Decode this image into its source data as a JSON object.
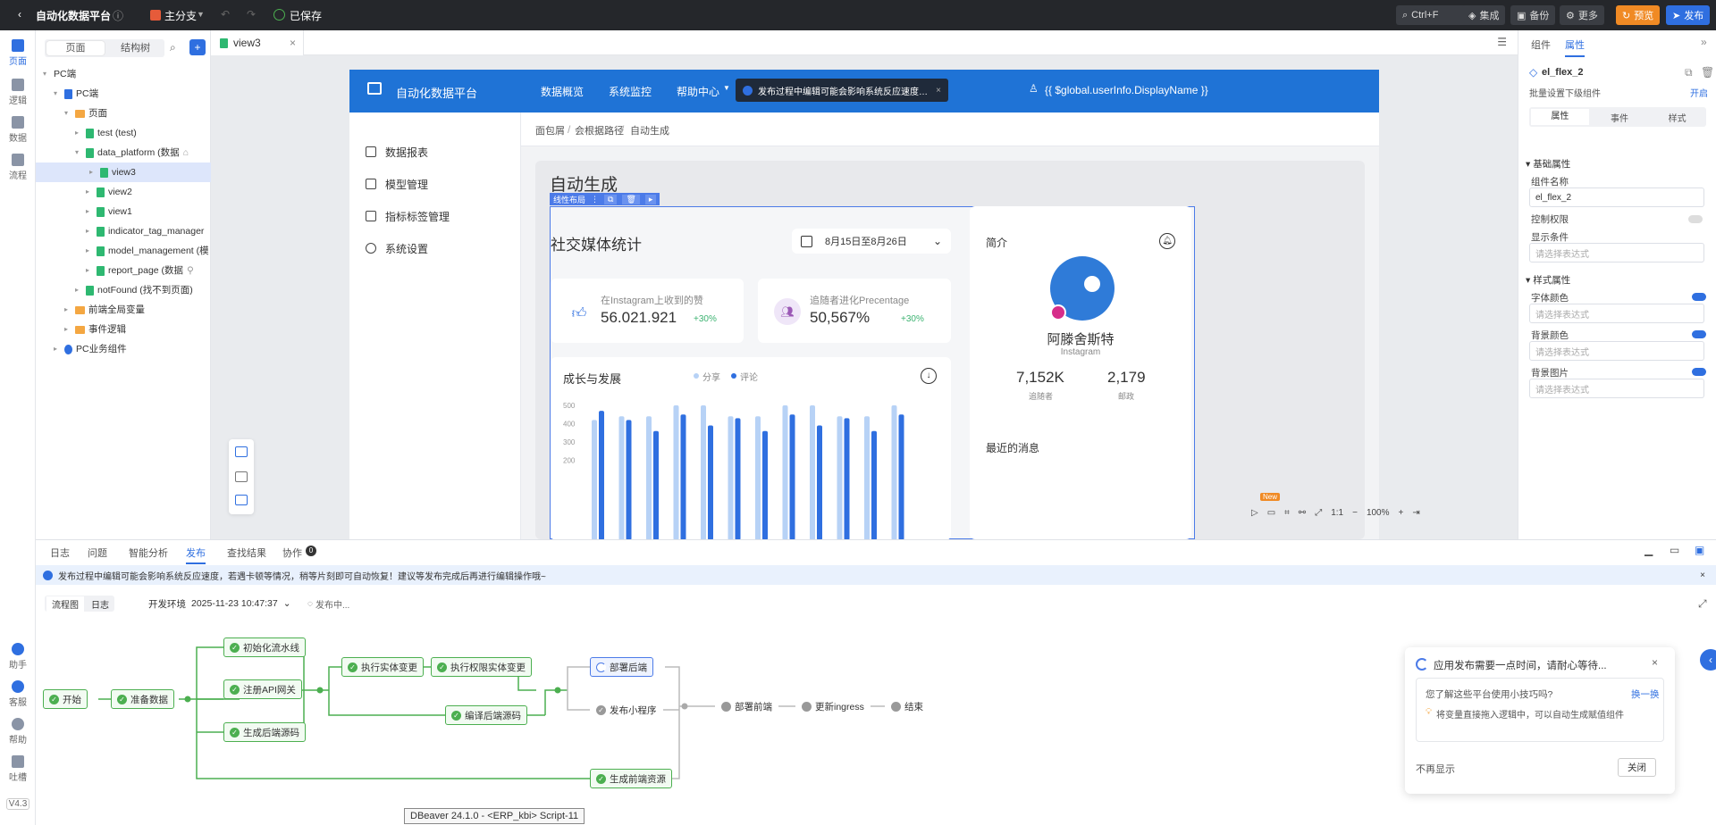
{
  "topbar": {
    "back_icon": "chevron-left-icon",
    "title": "自动化数据平台",
    "branch": "主分支",
    "saved": "已保存",
    "search_shortcut": "Ctrl+F",
    "integrate": "集成",
    "backup": "备份",
    "more": "更多",
    "preview": "预览",
    "publish": "发布"
  },
  "rail": {
    "items": [
      "页面",
      "逻辑",
      "数据",
      "流程"
    ],
    "bottom": [
      "助手",
      "客服",
      "帮助",
      "吐槽"
    ],
    "version": "V4.3"
  },
  "tree": {
    "tab_pages": "页面",
    "tab_structure": "结构树",
    "nodes": [
      {
        "label": "PC端"
      },
      {
        "label": "PC端"
      },
      {
        "label": "页面"
      },
      {
        "label": "test (test)"
      },
      {
        "label": "data_platform (数据"
      },
      {
        "label": "view3"
      },
      {
        "label": "view2"
      },
      {
        "label": "view1"
      },
      {
        "label": "indicator_tag_manager"
      },
      {
        "label": "model_management (模"
      },
      {
        "label": "report_page (数据"
      },
      {
        "label": "notFound (找不到页面)"
      },
      {
        "label": "前端全局变量"
      },
      {
        "label": "事件逻辑"
      },
      {
        "label": "PC业务组件"
      }
    ]
  },
  "editor_tab": {
    "label": "view3"
  },
  "app": {
    "title": "自动化数据平台",
    "nav": [
      "数据概览",
      "系统监控",
      "帮助中心"
    ],
    "toast": "发布过程中编辑可能会影响系统反应速度，请稍等片刻...",
    "user": "{{ $global.userInfo.DisplayName }}",
    "side": [
      "数据报表",
      "模型管理",
      "指标标签管理",
      "系统设置"
    ],
    "breadcrumb": [
      "面包屑",
      "会根据路径",
      "自动生成"
    ],
    "page_title": "自动生成",
    "selection_tag": "线性布局",
    "social_title": "社交媒体统计",
    "date_range": "8月15日至8月26日",
    "stat1_label": "在Instagram上收到的赞",
    "stat1_value": "56.021.921",
    "stat1_delta": "+30%",
    "stat2_label": "追随者进化Precentage",
    "stat2_value": "50,567%",
    "stat2_delta": "+30%",
    "growth_title": "成长与发展",
    "legend": [
      "分享",
      "评论"
    ],
    "intro_title": "简介",
    "profile_name": "阿滕舍斯特",
    "profile_sub": "Instagram",
    "followers": "7,152K",
    "followers_label": "追随者",
    "posts": "2,179",
    "posts_label": "邮政",
    "recent": "最近的消息",
    "new_badge": "New",
    "ratio": "1:1",
    "zoom": "100%"
  },
  "chart_data": {
    "type": "bar",
    "yticks": [
      500,
      400,
      300,
      200
    ],
    "series": [
      {
        "name": "分享",
        "values": [
          420,
          440,
          440,
          500,
          500,
          440,
          440,
          500,
          500,
          440,
          440,
          500
        ]
      },
      {
        "name": "评论",
        "values": [
          470,
          420,
          360,
          450,
          390,
          430,
          360,
          450,
          390,
          430,
          360,
          450
        ]
      }
    ],
    "colors": [
      "#b7d2f6",
      "#2f6fe0"
    ]
  },
  "right_panel": {
    "tab_components": "组件",
    "tab_props": "属性",
    "component_name": "el_flex_2",
    "batch_label": "批量设置下级组件",
    "batch_toggle": "开启",
    "sub_tabs": [
      "属性",
      "事件",
      "样式"
    ],
    "sec_basic": "基础属性",
    "name_label": "组件名称",
    "name_value": "el_flex_2",
    "perm_label": "控制权限",
    "show_label": "显示条件",
    "expr_placeholder": "请选择表达式",
    "sec_style": "样式属性",
    "font_color": "字体颜色",
    "bg_color": "背景颜色",
    "bg_image": "背景图片"
  },
  "bottom": {
    "tabs": [
      "日志",
      "问题",
      "智能分析",
      "发布",
      "查找结果",
      "协作"
    ],
    "collab_count": "0",
    "info": "发布过程中编辑可能会影响系统反应速度，若遇卡顿等情况，稍等片刻即可自动恢复！建议等发布完成后再进行编辑操作哦~",
    "view_flow": "流程图",
    "view_log": "日志",
    "env": "开发环境",
    "datetime": "2025-11-23 10:47:37",
    "status": "发布中...",
    "nodes": [
      "开始",
      "准备数据",
      "初始化流水线",
      "注册API网关",
      "生成后端源码",
      "执行实体变更",
      "执行权限实体变更",
      "编译后端源码",
      "部署后端",
      "发布小程序",
      "生成前端资源",
      "部署前端",
      "更新ingress",
      "结束"
    ],
    "tooltip": "DBeaver 24.1.0 - <ERP_kbi> Script-11"
  },
  "notice": {
    "title": "应用发布需要一点时间，请耐心等待...",
    "tip_title": "您了解这些平台使用小技巧吗?",
    "tip_switch": "换一换",
    "tip_text": "将变量直接拖入逻辑中，可以自动生成赋值组件",
    "no_show": "不再显示",
    "close": "关闭"
  }
}
